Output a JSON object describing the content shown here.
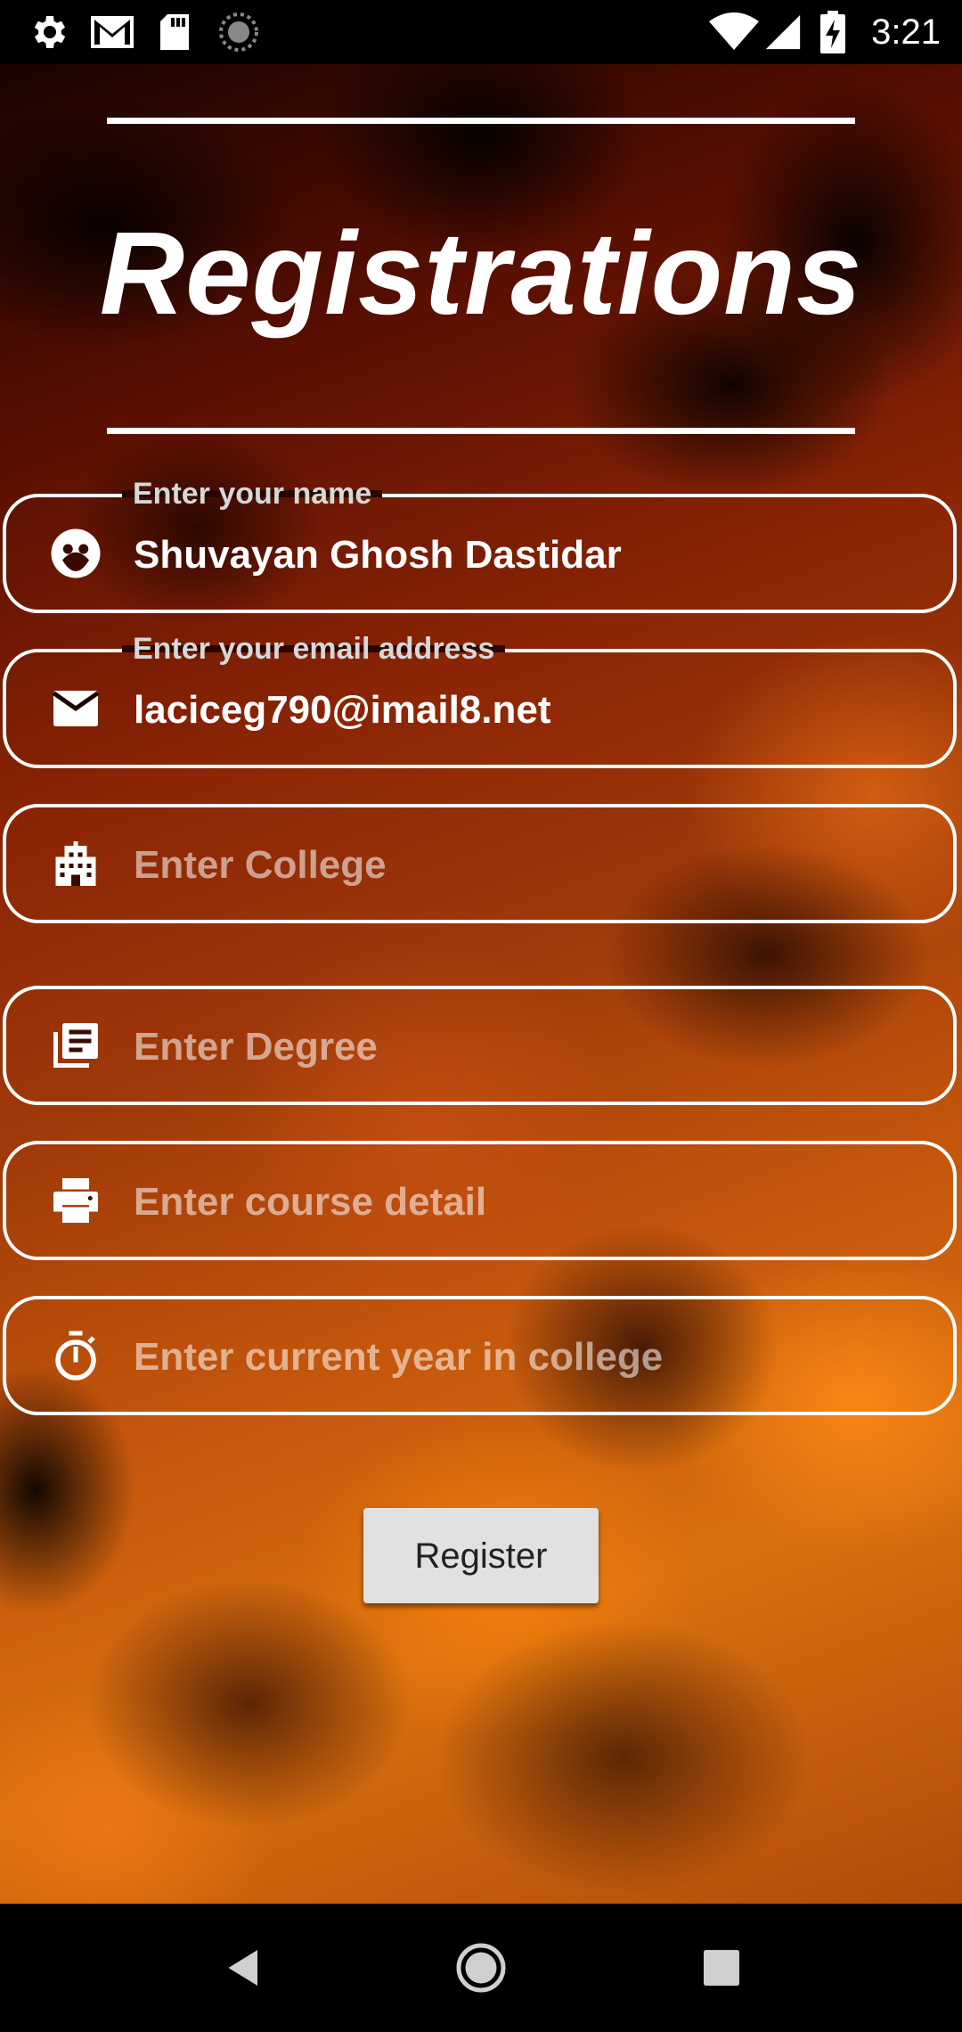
{
  "status_bar": {
    "time": "3:21",
    "icons_left": [
      "settings-icon",
      "gmail-icon",
      "sd-card-icon",
      "sync-icon"
    ],
    "icons_right": [
      "wifi-icon",
      "signal-icon",
      "battery-charging-icon"
    ]
  },
  "header": {
    "title": "Registrations"
  },
  "form": {
    "name": {
      "label": "Enter your name",
      "value": "Shuvayan Ghosh Dastidar",
      "icon": "face-icon"
    },
    "email": {
      "label": "Enter your email address",
      "value": "laciceg790@imail8.net",
      "icon": "email-icon"
    },
    "college": {
      "placeholder": "Enter College",
      "icon": "building-icon"
    },
    "degree": {
      "placeholder": "Enter Degree",
      "icon": "library-books-icon"
    },
    "course": {
      "placeholder": "Enter course detail",
      "icon": "printer-icon"
    },
    "year": {
      "placeholder": "Enter current year in college",
      "icon": "timer-icon"
    },
    "register_label": "Register"
  },
  "nav_bar": {
    "buttons": [
      "back-icon",
      "home-icon",
      "recents-icon"
    ]
  },
  "colors": {
    "accent": "#ffffff",
    "button_bg": "#e1e1e1",
    "background_dark": "#000000",
    "background_orange": "#d9700f"
  }
}
